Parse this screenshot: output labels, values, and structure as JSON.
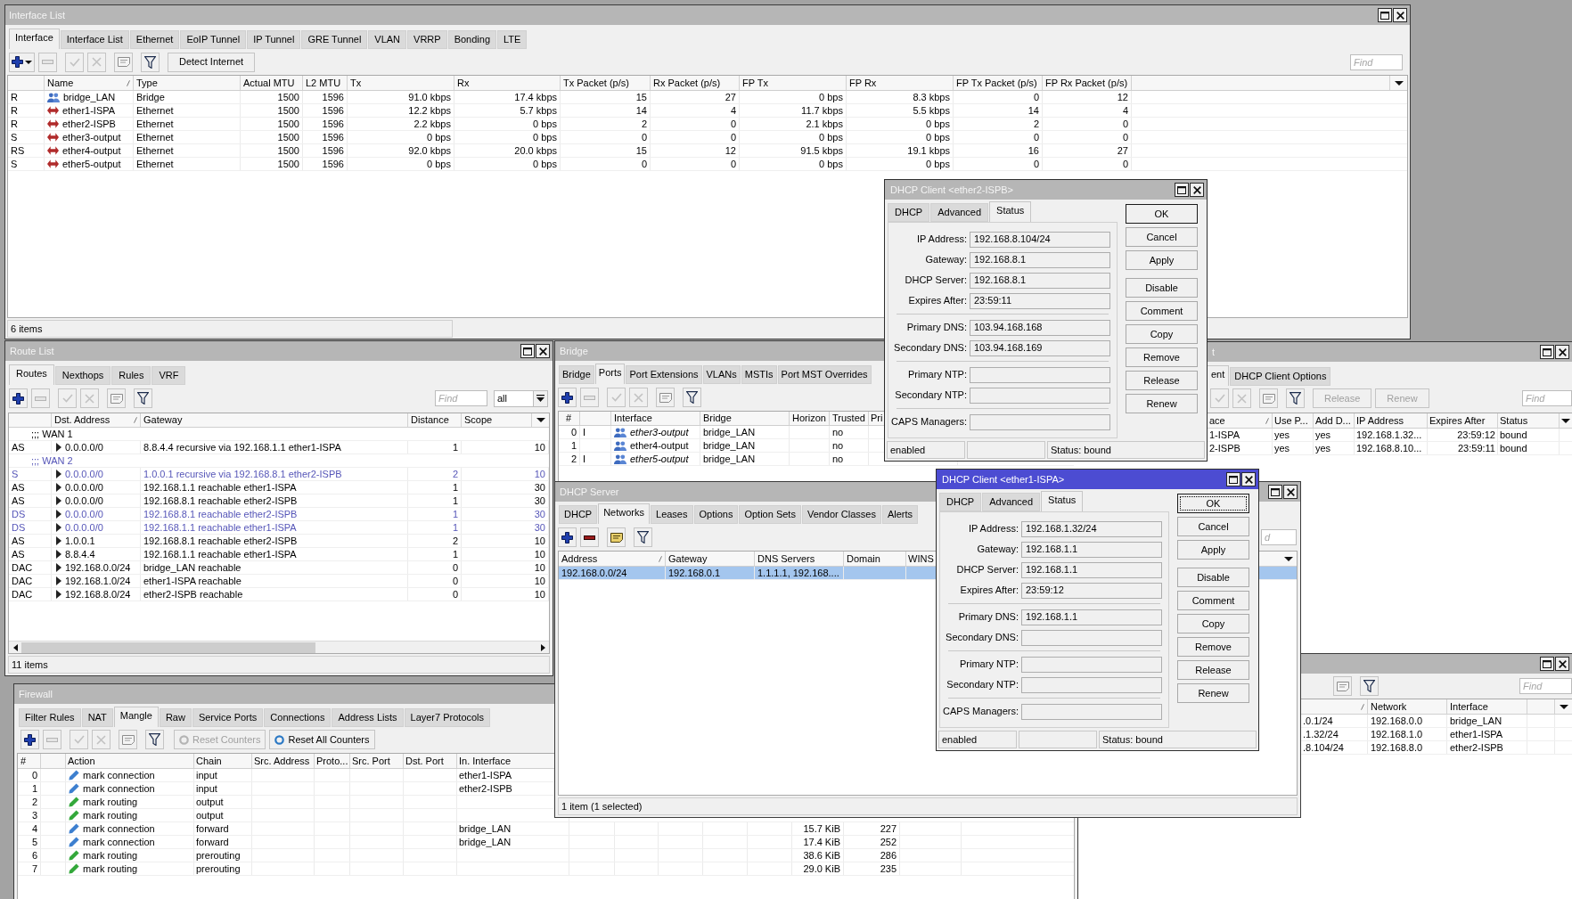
{
  "interface_list": {
    "title": "Interface List",
    "active": false,
    "tabs": [
      {
        "label": "Interface",
        "selected": true
      },
      {
        "label": "Interface List",
        "selected": false
      },
      {
        "label": "Ethernet",
        "selected": false
      },
      {
        "label": "EoIP Tunnel",
        "selected": false
      },
      {
        "label": "IP Tunnel",
        "selected": false
      },
      {
        "label": "GRE Tunnel",
        "selected": false
      },
      {
        "label": "VLAN",
        "selected": false
      },
      {
        "label": "VRRP",
        "selected": false
      },
      {
        "label": "Bonding",
        "selected": false
      },
      {
        "label": "LTE",
        "selected": false
      }
    ],
    "toolbar": [
      {
        "kind": "add_menu",
        "disabled": false
      },
      {
        "kind": "remove",
        "disabled": true
      },
      {
        "kind": "enable",
        "disabled": true
      },
      {
        "kind": "disable",
        "disabled": true
      },
      {
        "kind": "comment",
        "disabled": true
      },
      {
        "kind": "filter",
        "disabled": false
      },
      {
        "kind": "text",
        "label": "Detect Internet",
        "disabled": false
      },
      {
        "kind": "find",
        "placeholder": "Find"
      }
    ],
    "columns": [
      "Name",
      "Type",
      "Actual MTU",
      "L2 MTU",
      "Tx",
      "Rx",
      "Tx Packet (p/s)",
      "Rx Packet (p/s)",
      "FP Tx",
      "FP Rx",
      "FP Tx Packet (p/s)",
      "FP Rx Packet (p/s)"
    ],
    "rows": [
      {
        "flags": "R",
        "kind": "bridge",
        "cells": [
          "bridge_LAN",
          "Bridge",
          "1500",
          "1596",
          "91.0 kbps",
          "17.4 kbps",
          "15",
          "27",
          "0 bps",
          "8.3 kbps",
          "0",
          "12"
        ]
      },
      {
        "flags": "R",
        "kind": "ethernet",
        "cells": [
          "ether1-ISPA",
          "Ethernet",
          "1500",
          "1596",
          "12.2 kbps",
          "5.7 kbps",
          "14",
          "4",
          "11.7 kbps",
          "5.5 kbps",
          "14",
          "4"
        ]
      },
      {
        "flags": "R",
        "kind": "ethernet",
        "cells": [
          "ether2-ISPB",
          "Ethernet",
          "1500",
          "1596",
          "2.2 kbps",
          "0 bps",
          "2",
          "0",
          "2.1 kbps",
          "0 bps",
          "2",
          "0"
        ]
      },
      {
        "flags": "S",
        "kind": "ethernet",
        "cells": [
          "ether3-output",
          "Ethernet",
          "1500",
          "1596",
          "0 bps",
          "0 bps",
          "0",
          "0",
          "0 bps",
          "0 bps",
          "0",
          "0"
        ]
      },
      {
        "flags": "RS",
        "kind": "ethernet",
        "cells": [
          "ether4-output",
          "Ethernet",
          "1500",
          "1596",
          "92.0 kbps",
          "20.0 kbps",
          "15",
          "12",
          "91.5 kbps",
          "19.1 kbps",
          "16",
          "27"
        ]
      },
      {
        "flags": "S",
        "kind": "ethernet",
        "cells": [
          "ether5-output",
          "Ethernet",
          "1500",
          "1596",
          "0 bps",
          "0 bps",
          "0",
          "0",
          "0 bps",
          "0 bps",
          "0",
          "0"
        ]
      }
    ],
    "status": "6 items"
  },
  "dhcp_client_list": {
    "title": "t",
    "active": false,
    "tabs": [
      {
        "label": "ent",
        "selected": true
      },
      {
        "label": "DHCP Client Options",
        "selected": false
      }
    ],
    "toolbar": [
      {
        "kind": "enable",
        "disabled": true
      },
      {
        "kind": "disable",
        "disabled": true
      },
      {
        "kind": "comment",
        "disabled": true
      },
      {
        "kind": "filter",
        "disabled": false
      },
      {
        "kind": "text",
        "label": "Release",
        "disabled": true
      },
      {
        "kind": "text",
        "label": "Renew",
        "disabled": true
      },
      {
        "kind": "find",
        "placeholder": "Find"
      }
    ],
    "columns": [
      "ace",
      "Use P...",
      "Add D...",
      "IP Address",
      "Expires After",
      "Status"
    ],
    "rows": [
      {
        "cells": [
          "1-ISPA",
          "yes",
          "yes",
          "192.168.1.32...",
          "23:59:12",
          "bound"
        ]
      },
      {
        "cells": [
          "2-ISPB",
          "yes",
          "yes",
          "192.168.8.10...",
          "23:59:11",
          "bound"
        ]
      }
    ]
  },
  "address_list": {
    "active": false,
    "toolbar": [
      {
        "kind": "comment",
        "disabled": true
      },
      {
        "kind": "filter",
        "disabled": false
      },
      {
        "kind": "find",
        "placeholder": "Find"
      }
    ],
    "columns": [
      "Network",
      "Interface"
    ],
    "rows": [
      {
        "address": ".0.1/24",
        "network": "192.168.0.0",
        "interface": "bridge_LAN"
      },
      {
        "address": ".1.32/24",
        "network": "192.168.1.0",
        "interface": "ether1-ISPA"
      },
      {
        "address": ".8.104/24",
        "network": "192.168.8.0",
        "interface": "ether2-ISPB"
      }
    ]
  },
  "firewall": {
    "title": "Firewall",
    "active": false,
    "tabs": [
      {
        "label": "Filter Rules",
        "selected": false
      },
      {
        "label": "NAT",
        "selected": false
      },
      {
        "label": "Mangle",
        "selected": true
      },
      {
        "label": "Raw",
        "selected": false
      },
      {
        "label": "Service Ports",
        "selected": false
      },
      {
        "label": "Connections",
        "selected": false
      },
      {
        "label": "Address Lists",
        "selected": false
      },
      {
        "label": "Layer7 Protocols",
        "selected": false
      }
    ],
    "toolbar": [
      {
        "kind": "add",
        "disabled": false
      },
      {
        "kind": "remove",
        "disabled": true
      },
      {
        "kind": "enable",
        "disabled": true
      },
      {
        "kind": "disable",
        "disabled": true
      },
      {
        "kind": "comment",
        "disabled": true
      },
      {
        "kind": "filter",
        "disabled": false
      },
      {
        "kind": "reset",
        "label": "Reset Counters",
        "disabled": true
      },
      {
        "kind": "reset",
        "label": "Reset All Counters",
        "disabled": false
      }
    ],
    "columns": [
      "#",
      "Action",
      "Chain",
      "Src. Address",
      "Proto...",
      "Src. Port",
      "Dst. Port",
      "In. Interface"
    ],
    "rows": [
      {
        "number": "0",
        "action": "mark connection",
        "color": "#3d7fcf",
        "chain": "input",
        "in_interface": "ether1-ISPA"
      },
      {
        "number": "1",
        "action": "mark connection",
        "color": "#3d7fcf",
        "chain": "input",
        "in_interface": "ether2-ISPB"
      },
      {
        "number": "2",
        "action": "mark routing",
        "color": "#33a83a",
        "chain": "output"
      },
      {
        "number": "3",
        "action": "mark routing",
        "color": "#33a83a",
        "chain": "output"
      },
      {
        "number": "4",
        "action": "mark connection",
        "color": "#3d7fcf",
        "chain": "forward",
        "in_interface": "bridge_LAN",
        "column_15": "15.7 KiB",
        "column_16": "227"
      },
      {
        "number": "5",
        "action": "mark connection",
        "color": "#3d7fcf",
        "chain": "forward",
        "in_interface": "bridge_LAN",
        "column_15": "17.4 KiB",
        "column_16": "252"
      },
      {
        "number": "6",
        "action": "mark routing",
        "color": "#33a83a",
        "chain": "prerouting",
        "column_15": "38.6 KiB",
        "column_16": "286"
      },
      {
        "number": "7",
        "action": "mark routing",
        "color": "#33a83a",
        "chain": "prerouting",
        "column_15": "29.0 KiB",
        "column_16": "235"
      }
    ]
  },
  "route_list": {
    "title": "Route List",
    "active": false,
    "tabs": [
      {
        "label": "Routes",
        "selected": true
      },
      {
        "label": "Nexthops",
        "selected": false
      },
      {
        "label": "Rules",
        "selected": false
      },
      {
        "label": "VRF",
        "selected": false
      }
    ],
    "toolbar": [
      {
        "kind": "add",
        "disabled": false
      },
      {
        "kind": "remove",
        "disabled": true
      },
      {
        "kind": "enable",
        "disabled": true
      },
      {
        "kind": "disable",
        "disabled": true
      },
      {
        "kind": "comment",
        "disabled": true
      },
      {
        "kind": "filter",
        "disabled": false
      },
      {
        "kind": "find",
        "placeholder": "Find"
      },
      {
        "kind": "select",
        "value": "all"
      }
    ],
    "columns": [
      "Dst. Address",
      "Gateway",
      "Distance",
      "Scope"
    ],
    "rows": [
      {
        "kind": "comment",
        "text": ";;; WAN 1",
        "inactive": false
      },
      {
        "kind": "route",
        "flags": "AS",
        "inactive": false,
        "dst": "0.0.0.0/0",
        "gateway": "8.8.4.4 recursive via 192.168.1.1 ether1-ISPA",
        "distance": "1",
        "scope": "10"
      },
      {
        "kind": "comment",
        "text": ";;; WAN 2",
        "inactive": true
      },
      {
        "kind": "route",
        "flags": "S",
        "inactive": true,
        "dst": "0.0.0.0/0",
        "gateway": "1.0.0.1 recursive via 192.168.8.1 ether2-ISPB",
        "distance": "2",
        "scope": "10"
      },
      {
        "kind": "route",
        "flags": "AS",
        "inactive": false,
        "dst": "0.0.0.0/0",
        "gateway": "192.168.1.1 reachable ether1-ISPA",
        "distance": "1",
        "scope": "30"
      },
      {
        "kind": "route",
        "flags": "AS",
        "inactive": false,
        "dst": "0.0.0.0/0",
        "gateway": "192.168.8.1 reachable ether2-ISPB",
        "distance": "1",
        "scope": "30"
      },
      {
        "kind": "route",
        "flags": "DS",
        "inactive": true,
        "dst": "0.0.0.0/0",
        "gateway": "192.168.8.1 reachable ether2-ISPB",
        "distance": "1",
        "scope": "30"
      },
      {
        "kind": "route",
        "flags": "DS",
        "inactive": true,
        "dst": "0.0.0.0/0",
        "gateway": "192.168.1.1 reachable ether1-ISPA",
        "distance": "1",
        "scope": "30"
      },
      {
        "kind": "route",
        "flags": "AS",
        "inactive": false,
        "dst": "1.0.0.1",
        "gateway": "192.168.8.1 reachable ether2-ISPB",
        "distance": "2",
        "scope": "10"
      },
      {
        "kind": "route",
        "flags": "AS",
        "inactive": false,
        "dst": "8.8.4.4",
        "gateway": "192.168.1.1 reachable ether1-ISPA",
        "distance": "1",
        "scope": "10"
      },
      {
        "kind": "route",
        "flags": "DAC",
        "inactive": false,
        "dst": "192.168.0.0/24",
        "gateway": "bridge_LAN reachable",
        "distance": "0",
        "scope": "10"
      },
      {
        "kind": "route",
        "flags": "DAC",
        "inactive": false,
        "dst": "192.168.1.0/24",
        "gateway": "ether1-ISPA reachable",
        "distance": "0",
        "scope": "10"
      },
      {
        "kind": "route",
        "flags": "DAC",
        "inactive": false,
        "dst": "192.168.8.0/24",
        "gateway": "ether2-ISPB reachable",
        "distance": "0",
        "scope": "10"
      }
    ],
    "status": "11 items"
  },
  "bridge": {
    "title": "Bridge",
    "active": false,
    "tabs": [
      {
        "label": "Bridge",
        "selected": false
      },
      {
        "label": "Ports",
        "selected": true
      },
      {
        "label": "Port Extensions",
        "selected": false
      },
      {
        "label": "VLANs",
        "selected": false
      },
      {
        "label": "MSTIs",
        "selected": false
      },
      {
        "label": "Port MST Overrides",
        "selected": false
      }
    ],
    "toolbar": [
      {
        "kind": "add",
        "disabled": false
      },
      {
        "kind": "remove",
        "disabled": true
      },
      {
        "kind": "enable",
        "disabled": true
      },
      {
        "kind": "disable",
        "disabled": true
      },
      {
        "kind": "comment",
        "disabled": true
      },
      {
        "kind": "filter",
        "disabled": false
      }
    ],
    "columns": [
      "#",
      "Interface",
      "Bridge",
      "Horizon",
      "Trusted",
      "Pri"
    ],
    "rows": [
      {
        "number": "0",
        "flag": "I",
        "inactive": true,
        "interface": "ether3-output",
        "bridge": "bridge_LAN",
        "trusted": "no"
      },
      {
        "number": "1",
        "inactive": false,
        "interface": "ether4-output",
        "bridge": "bridge_LAN",
        "trusted": "no"
      },
      {
        "number": "2",
        "flag": "I",
        "inactive": true,
        "interface": "ether5-output",
        "bridge": "bridge_LAN",
        "trusted": "no"
      }
    ]
  },
  "dhcp_server": {
    "title": "DHCP Server",
    "active": false,
    "tabs": [
      {
        "label": "DHCP",
        "selected": false
      },
      {
        "label": "Networks",
        "selected": true
      },
      {
        "label": "Leases",
        "selected": false
      },
      {
        "label": "Options",
        "selected": false
      },
      {
        "label": "Option Sets",
        "selected": false
      },
      {
        "label": "Vendor Classes",
        "selected": false
      },
      {
        "label": "Alerts",
        "selected": false
      }
    ],
    "toolbar": [
      {
        "kind": "add",
        "disabled": false
      },
      {
        "kind": "remove",
        "disabled": false
      },
      {
        "kind": "comment",
        "disabled": false
      },
      {
        "kind": "filter",
        "disabled": false
      },
      {
        "kind": "find",
        "placeholder": "d"
      }
    ],
    "columns": [
      "Address",
      "Gateway",
      "DNS Servers",
      "Domain",
      "WINS"
    ],
    "rows": [
      {
        "selected": true,
        "address": "192.168.0.0/24",
        "gateway": "192.168.0.1",
        "dns_servers": "1.1.1.1, 192.168...."
      }
    ],
    "status": "1 item (1 selected)"
  },
  "dhcp_client_ether2": {
    "title": "DHCP Client <ether2-ISPB>",
    "active": false,
    "tabs": [
      {
        "label": "DHCP",
        "selected": false
      },
      {
        "label": "Advanced",
        "selected": false
      },
      {
        "label": "Status",
        "selected": true
      }
    ],
    "field_groups": [
      [
        {
          "label": "IP Address:",
          "value": "192.168.8.104/24"
        },
        {
          "label": "Gateway:",
          "value": "192.168.8.1"
        },
        {
          "label": "DHCP Server:",
          "value": "192.168.8.1"
        },
        {
          "label": "Expires After:",
          "value": "23:59:11"
        }
      ],
      [
        {
          "label": "Primary DNS:",
          "value": "103.94.168.168"
        },
        {
          "label": "Secondary DNS:",
          "value": "103.94.168.169"
        }
      ],
      [
        {
          "label": "Primary NTP:"
        },
        {
          "label": "Secondary NTP:"
        }
      ],
      [
        {
          "label": "CAPS Managers:"
        }
      ]
    ],
    "button_groups": [
      [
        "OK",
        "Cancel",
        "Apply"
      ],
      [
        "Disable",
        "Comment",
        "Copy",
        "Remove",
        "Release",
        "Renew"
      ]
    ],
    "status_bar": {
      "state": "enabled",
      "status": "Status: bound"
    }
  },
  "dhcp_client_ether1": {
    "title": "DHCP Client <ether1-ISPA>",
    "active": true,
    "tabs": [
      {
        "label": "DHCP",
        "selected": false
      },
      {
        "label": "Advanced",
        "selected": false
      },
      {
        "label": "Status",
        "selected": true
      }
    ],
    "field_groups": [
      [
        {
          "label": "IP Address:",
          "value": "192.168.1.32/24"
        },
        {
          "label": "Gateway:",
          "value": "192.168.1.1"
        },
        {
          "label": "DHCP Server:",
          "value": "192.168.1.1"
        },
        {
          "label": "Expires After:",
          "value": "23:59:12"
        }
      ],
      [
        {
          "label": "Primary DNS:",
          "value": "192.168.1.1"
        },
        {
          "label": "Secondary DNS:"
        }
      ],
      [
        {
          "label": "Primary NTP:"
        },
        {
          "label": "Secondary NTP:"
        }
      ],
      [
        {
          "label": "CAPS Managers:"
        }
      ]
    ],
    "button_groups": [
      [
        "OK",
        "Cancel",
        "Apply"
      ],
      [
        "Disable",
        "Comment",
        "Copy",
        "Remove",
        "Release",
        "Renew"
      ]
    ],
    "status_bar": {
      "state": "enabled",
      "status": "Status: bound"
    }
  }
}
